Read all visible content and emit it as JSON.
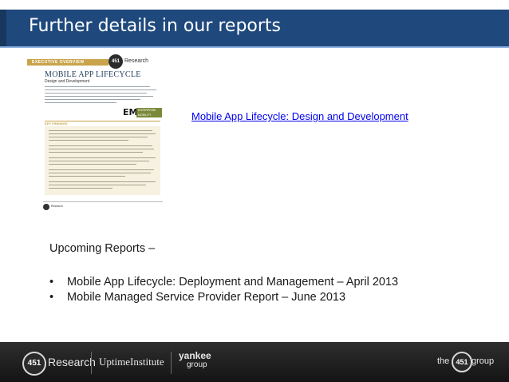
{
  "slide": {
    "title": "Further details in our reports",
    "report_link": "Mobile App Lifecycle: Design and Development",
    "upcoming_heading": "Upcoming Reports –",
    "upcoming_items": [
      "Mobile App Lifecycle: Deployment and Management – April 2013",
      "Mobile Managed Service Provider Report – June 2013"
    ],
    "bullet_glyph": "•"
  },
  "report_thumbnail": {
    "section_label": "EXECUTIVE OVERVIEW",
    "logo_number": "451",
    "logo_word": "Research",
    "doc_title": "MOBILE APP LIFECYCLE",
    "doc_subtitle": "Design and Development",
    "em_letters": "EM",
    "em_tag": "ENTERPRISE MOBILITY",
    "key_findings_label": "KEY FINDINGS",
    "footer_word": "Research"
  },
  "footer": {
    "brand_number": "451",
    "brand_word": "Research",
    "uptime": "UptimeInstitute",
    "yankee": "yankee",
    "yankee_group": "group",
    "the": "the",
    "the451": "451",
    "group_word": "group"
  },
  "colors": {
    "title_bar": "#1f497d",
    "link": "#0000ee",
    "footer_bg": "#1e1e1e",
    "thumbnail_accent": "#c9a44b"
  }
}
